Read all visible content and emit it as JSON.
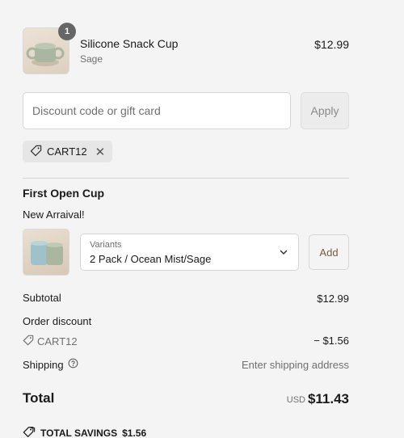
{
  "line_item": {
    "quantity": "1",
    "name": "Silicone Snack Cup",
    "variant": "Sage",
    "price": "$12.99"
  },
  "discount": {
    "placeholder": "Discount code or gift card",
    "value": "",
    "apply_label": "Apply",
    "applied_code": "CART12",
    "remove_glyph": "✕"
  },
  "upsell": {
    "title": "First Open Cup",
    "subtitle": "New Arraival!",
    "variant_label": "Variants",
    "variant_value": "2 Pack / Ocean Mist/Sage",
    "add_label": "Add"
  },
  "summary": {
    "subtotal_label": "Subtotal",
    "subtotal_value": "$12.99",
    "order_discount_label": "Order discount",
    "discount_code": "CART12",
    "discount_value": "− $1.56",
    "shipping_label": "Shipping",
    "shipping_value": "Enter shipping address",
    "total_label": "Total",
    "currency": "USD",
    "total_value": "$11.43",
    "savings_label": "TOTAL SAVINGS",
    "savings_value": "$1.56"
  },
  "colors": {
    "background": "#f4f4f4",
    "add_button_text": "#7a5a40",
    "muted_text": "#707070"
  },
  "icons": [
    "tag-icon",
    "close-icon",
    "chevron-down-icon",
    "help-circle-icon"
  ]
}
